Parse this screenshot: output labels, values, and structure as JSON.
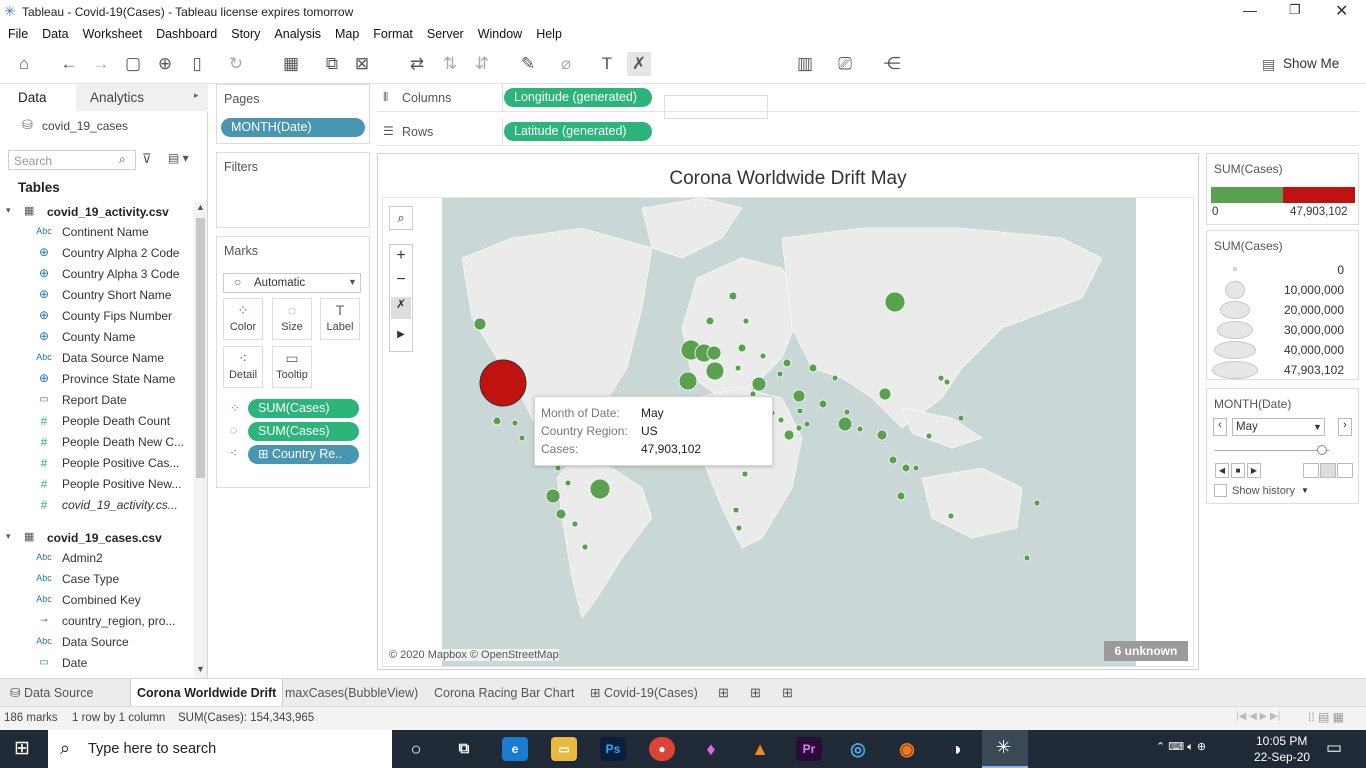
{
  "window": {
    "title": "Tableau - Covid-19(Cases) - Tableau license expires tomorrow"
  },
  "menu": [
    "File",
    "Data",
    "Worksheet",
    "Dashboard",
    "Story",
    "Analysis",
    "Map",
    "Format",
    "Server",
    "Window",
    "Help"
  ],
  "toolbar": {
    "show_me": "Show Me"
  },
  "data_pane": {
    "tab_data": "Data",
    "tab_analytics": "Analytics",
    "datasource": "covid_19_cases",
    "search_placeholder": "Search",
    "tables_heading": "Tables",
    "table1": "covid_19_activity.csv",
    "table1_fields": [
      {
        "type": "Abc",
        "name": "Continent Name"
      },
      {
        "type": "geo",
        "name": "Country Alpha 2 Code"
      },
      {
        "type": "geo",
        "name": "Country Alpha 3 Code"
      },
      {
        "type": "geo",
        "name": "Country Short Name"
      },
      {
        "type": "geo",
        "name": "County Fips Number"
      },
      {
        "type": "geo",
        "name": "County Name"
      },
      {
        "type": "Abc",
        "name": "Data Source Name"
      },
      {
        "type": "geo",
        "name": "Province State Name"
      },
      {
        "type": "date",
        "name": "Report Date"
      },
      {
        "type": "#",
        "name": "People Death Count"
      },
      {
        "type": "#",
        "name": "People Death New C..."
      },
      {
        "type": "#",
        "name": "People Positive Cas..."
      },
      {
        "type": "#",
        "name": "People Positive New..."
      },
      {
        "type": "#",
        "name": "covid_19_activity.cs..."
      }
    ],
    "table2": "covid_19_cases.csv",
    "table2_fields": [
      {
        "type": "Abc",
        "name": "Admin2"
      },
      {
        "type": "Abc",
        "name": "Case Type"
      },
      {
        "type": "Abc",
        "name": "Combined Key"
      },
      {
        "type": "hier",
        "name": "country_region, pro..."
      },
      {
        "type": "Abc",
        "name": "Data Source"
      },
      {
        "type": "date",
        "name": "Date"
      }
    ]
  },
  "shelves": {
    "pages_label": "Pages",
    "pages_pill": "MONTH(Date)",
    "filters_label": "Filters",
    "marks_label": "Marks",
    "mark_type": "Automatic",
    "color": "Color",
    "size": "Size",
    "label": "Label",
    "detail": "Detail",
    "tooltip": "Tooltip",
    "mark_pills": [
      "SUM(Cases)",
      "SUM(Cases)",
      "Country Re.."
    ],
    "columns_label": "Columns",
    "columns_pill": "Longitude (generated)",
    "rows_label": "Rows",
    "rows_pill": "Latitude (generated)"
  },
  "viz": {
    "title": "Corona Worldwide Drift  May",
    "attribution": "© 2020 Mapbox © OpenStreetMap",
    "unknown": "6 unknown",
    "tooltip": {
      "k1": "Month of Date:",
      "v1": "May",
      "k2": "Country Region:",
      "v2": "US",
      "k3": "Cases:",
      "v3": "47,903,102"
    },
    "colors": {
      "green": "#59a14f",
      "red": "#c0120f"
    }
  },
  "legend_color": {
    "title": "SUM(Cases)",
    "min": "0",
    "max": "47,903,102"
  },
  "legend_size": {
    "title": "SUM(Cases)",
    "items": [
      "0",
      "10,000,000",
      "20,000,000",
      "30,000,000",
      "40,000,000",
      "47,903,102"
    ]
  },
  "page_ctrl": {
    "title": "MONTH(Date)",
    "value": "May",
    "show_history": "Show history"
  },
  "tabs": [
    "Data Source",
    "Corona Worldwide Drift",
    "maxCases(BubbleView)",
    "Corona Racing Bar Chart",
    "Covid-19(Cases)"
  ],
  "status": {
    "marks": "186 marks",
    "rowscols": "1 row by 1 column",
    "sum": "SUM(Cases): 154,343,965"
  },
  "taskbar": {
    "search": "Type here to search",
    "time": "10:05 PM",
    "date": "22-Sep-20"
  }
}
